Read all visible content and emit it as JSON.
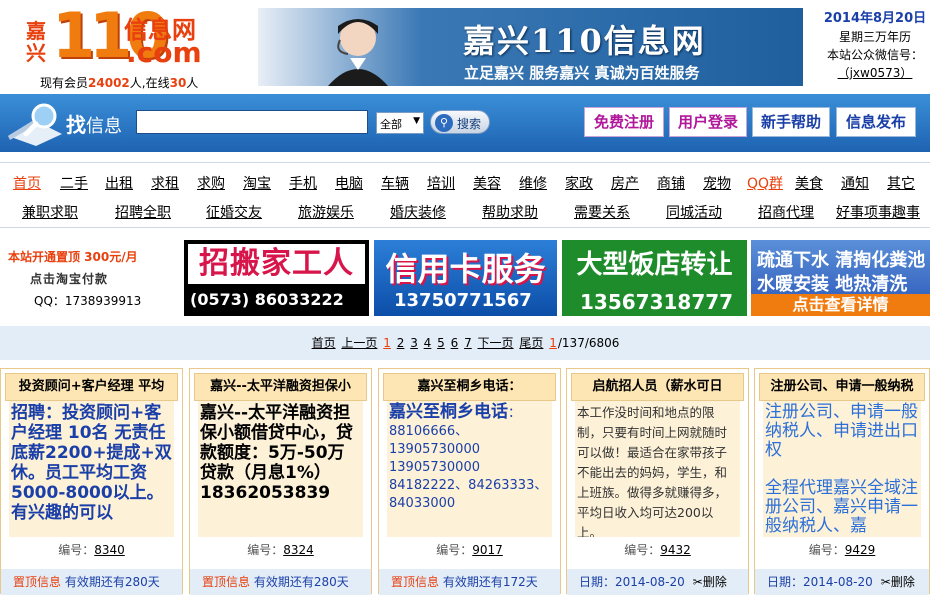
{
  "header": {
    "logo_jx": "嘉兴",
    "logo_num": "110",
    "logo_xxw": "信息网",
    "logo_com": ".com",
    "members_prefix": "现有会员",
    "members_count": "24002",
    "members_mid": "人,在线",
    "online_count": "30",
    "members_suffix": "人",
    "banner_title": "嘉兴110信息网",
    "banner_slogan": "立足嘉兴   服务嘉兴   真诚为百姓服务",
    "date": "2014年8月20日",
    "lunar_link": "星期三万年历",
    "wx_label": "本站公众微信号：",
    "wx_id": "（jxw0573）"
  },
  "search": {
    "label_big": "找",
    "label_small": "信息",
    "placeholder": "",
    "scope": "全部",
    "button": "搜索"
  },
  "top_buttons": {
    "register": "免费注册",
    "login": "用户登录",
    "help": "新手帮助",
    "post": "信息发布"
  },
  "nav": {
    "row1": [
      "首页",
      "二手",
      "出租",
      "求租",
      "求购",
      "淘宝",
      "手机",
      "电脑",
      "车辆",
      "培训",
      "美容",
      "维修",
      "家政",
      "房产",
      "商铺",
      "宠物",
      "QQ群",
      "美食",
      "通知",
      "其它"
    ],
    "row2": [
      "兼职求职",
      "招聘全职",
      "征婚交友",
      "旅游娱乐",
      "婚庆装修",
      "帮助求助",
      "需要关系",
      "同城活动",
      "招商代理",
      "好事项事趣事"
    ]
  },
  "ads": {
    "promo_line1": "本站开通置顶  300元/月",
    "promo_line2": "点击淘宝付款",
    "promo_line3": "QQ：1738939913",
    "ad1_title": "招搬家工人",
    "ad1_phone": "(0573) 86033222",
    "ad2_title": "信用卡服务",
    "ad2_phone": "13750771567",
    "ad3_title": "大型饭店转让",
    "ad3_phone": "13567318777",
    "ad4_line1": "疏通下水  清掏化粪池",
    "ad4_line2": "水暖安装  地热清洗",
    "ad4_cta": "点击查看详情"
  },
  "pager": {
    "first": "首页",
    "prev": "上一页",
    "pages": [
      "1",
      "2",
      "3",
      "4",
      "5",
      "6",
      "7"
    ],
    "next": "下一页",
    "last": "尾页",
    "current": "1",
    "total": "/137/6806"
  },
  "cards": [
    {
      "title": "投资顾问+客户经理 平均",
      "body": "招聘：投资顾问+客户经理 10名 无责任底薪2200+提成+双休。员工平均工资5000-8000以上。有兴趣的可以",
      "id_label": "编号：",
      "id": "8340",
      "foot_pin": "置顶信息",
      "foot_text": "有效期还有280天"
    },
    {
      "title": "嘉兴--太平洋融资担保小",
      "body": "嘉兴--太平洋融资担保小额借贷中心，贷款额度：5万-50万贷款（月息1%）18362053839",
      "id_label": "编号：",
      "id": "8324",
      "foot_pin": "置顶信息",
      "foot_text": "有效期还有280天"
    },
    {
      "title": "嘉兴至桐乡电话：",
      "body_big": "嘉兴至桐乡电话",
      "body": "：88106666、13905730000  13905730000 84182222、84263333、84033000",
      "id_label": "编号：",
      "id": "9017",
      "foot_pin": "置顶信息",
      "foot_text": "有效期还有172天"
    },
    {
      "title": "启航招人员（薪水可日",
      "body": "本工作没时间和地点的限制，只要有时间上网就随时可以做！最适合在家带孩子不能出去的妈妈，学生，和上班族。做得多就赚得多，平均日收入均可达200以上。",
      "id_label": "编号：",
      "id": "9432",
      "foot_date": "日期：2014-08-20",
      "foot_del": "删除"
    },
    {
      "title": "注册公司、申请一般纳税",
      "body": "注册公司、申请一般纳税人、申请进出口权\n\n全程代理嘉兴全域注册公司、嘉兴申请一般纳税人、嘉",
      "id_label": "编号：",
      "id": "9429",
      "foot_date": "日期：2014-08-20",
      "foot_del": "删除"
    }
  ],
  "colors": {
    "brand_orange": "#f07c10",
    "brand_red": "#e8400e",
    "bar_blue": "#1e63b2",
    "link_blue": "#1a3fa8"
  }
}
